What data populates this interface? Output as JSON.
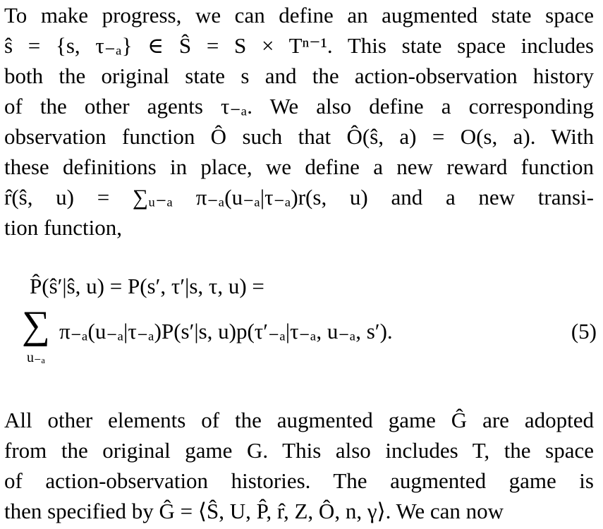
{
  "paragraph1": {
    "lines": [
      "To make progress, we can define an augmented state space",
      "ŝ = {s, τ₋ₐ} ∈ Ŝ = S × Tⁿ⁻¹. This state space includes",
      "both the original state s and the action-observation history",
      "of the other agents τ₋ₐ.  We also define a corresponding",
      "observation function Ô such that Ô(ŝ, a) = O(s, a). With",
      "these definitions in place, we define a new reward function",
      "r̂(ŝ, u) = ∑ᵤ₋ₐ π₋ₐ(u₋ₐ|τ₋ₐ)r(s, u) and a new transi-",
      "tion function,"
    ]
  },
  "equation": {
    "line1": "P̂(ŝ′|ŝ, u) = P(s′, τ′|s, τ, u) =",
    "sum_symbol": "∑",
    "sum_subscript": "u₋ₐ",
    "line2": "π₋ₐ(u₋ₐ|τ₋ₐ)P(s′|s, u)p(τ′₋ₐ|τ₋ₐ, u₋ₐ, s′).",
    "number": "(5)"
  },
  "paragraph2": {
    "lines": [
      "All other elements of the augmented game Ĝ are adopted",
      "from the original game G. This also includes T, the space",
      "of action-observation histories.  The augmented game is",
      "then specified by Ĝ = ⟨Ŝ, U, P̂, r̂, Z, Ô, n, γ⟩. We can now"
    ]
  }
}
